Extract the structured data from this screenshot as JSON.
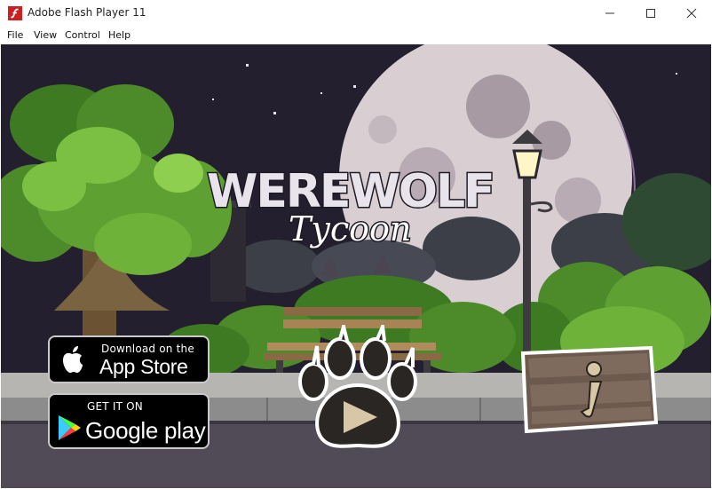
{
  "window": {
    "title": "Adobe Flash Player 11",
    "controls": {
      "minimize": "minimize",
      "maximize": "maximize",
      "close": "close"
    }
  },
  "menu": [
    "File",
    "View",
    "Control",
    "Help"
  ],
  "game": {
    "logo_line1": "WEREWOLF",
    "logo_line2": "Tycoon",
    "app_store": {
      "small": "Download on the",
      "big": "App Store"
    },
    "google_play": {
      "small": "GET IT ON",
      "big": "Google play"
    },
    "play_icon": "paw-play-icon",
    "info_icon": "wooden-sign-info-icon"
  },
  "colors": {
    "sky": "#231f2e",
    "moon": "#d9cfd3",
    "foliage": "#5fa032",
    "pavement": "#8d8c8d",
    "road": "#504b57"
  }
}
